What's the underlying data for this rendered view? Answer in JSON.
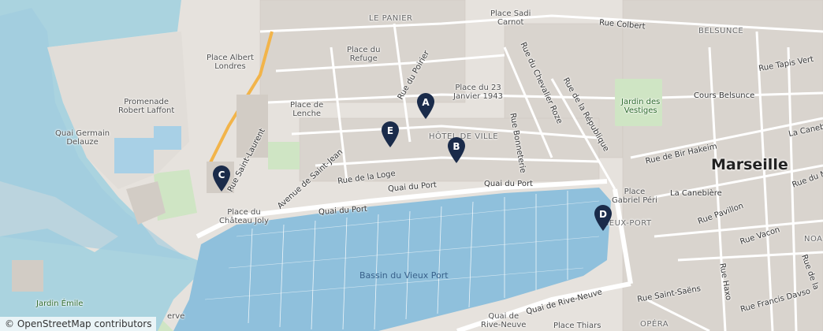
{
  "map": {
    "attribution_symbol": "©",
    "attribution_link": "OpenStreetMap",
    "attribution_suffix": " contributors",
    "labels": {
      "le_panier": "LE PANIER",
      "place_sadi_carnot": "Place Sadi\nCarnot",
      "rue_colbert": "Rue Colbert",
      "belsunce": "BELSUNCE",
      "rue_tapis_vert": "Rue Tapis Vert",
      "place_du_refuge": "Place du\nRefuge",
      "place_albert_londres": "Place Albert\nLondres",
      "rue_du_poirier": "Rue du Poirier",
      "place_23_janvier": "Place du 23\nJanvier 1943",
      "rue_chevalier_roze": "Rue du Chevalier Roze",
      "rue_republique": "Rue de la République",
      "jardin_des_vestiges": "Jardin des\nVestiges",
      "cours_belsunce": "Cours Belsunce",
      "promenade": "Promenade\nRobert Laffont",
      "place_de_lenche": "Place de\nLenche",
      "quai_germain": "Quai Germain\nDelauze",
      "hotel_de_ville": "HÔTEL DE VILLE",
      "rue_bonneterie": "Rue Bonneterie",
      "rue_saint_laurent": "Rue Saint-Laurent",
      "avenue_saint_jean": "Avenue de Saint-Jean",
      "rue_de_la_loge": "Rue de la Loge",
      "quai_du_port_1": "Quai du Port",
      "quai_du_port_2": "Quai du Port",
      "quai_du_port_3": "Quai du Port",
      "rue_bir_hakeim": "Rue de Bir Hakeim",
      "marseille": "Marseille",
      "la_canebiere": "La Canebière",
      "place_gabriel_peri": "Place\nGabriel Péri",
      "vieux_port": "VIEUX-PORT",
      "rue_pavillon": "Rue Pavillon",
      "rue_vacon": "Rue Vacon",
      "place_chateau_joly": "Place du\nChâteau Joly",
      "bassin": "Bassin du Vieux Port",
      "quai_rive_neuve_1": "Quai de\nRive-Neuve",
      "quai_rive_neuve_2": "Quai de Rive-Neuve",
      "rue_saint_saens": "Rue Saint-Saëns",
      "rue_haxo": "Rue Haxo",
      "rue_francis_davso": "Rue Francis Davso",
      "place_thiars": "Place Thiars",
      "opera": "OPÉRA",
      "jardin_emile": "Jardin Émile",
      "la_canebiere_2": "La Canebi",
      "rue_du_m": "Rue du M",
      "noa": "NOA",
      "rue_la": "Rue de la",
      "serve": "erve"
    },
    "markers": [
      {
        "label": "A"
      },
      {
        "label": "B"
      },
      {
        "label": "C"
      },
      {
        "label": "D"
      },
      {
        "label": "E"
      }
    ],
    "colors": {
      "water": "#aad3df",
      "deep_water": "#8fbcd8",
      "land": "#e9e6e2",
      "buildings": "#d8d3cd",
      "park": "#cfe5c4",
      "road": "#ffffff",
      "marker": "#1a2b4a"
    }
  }
}
